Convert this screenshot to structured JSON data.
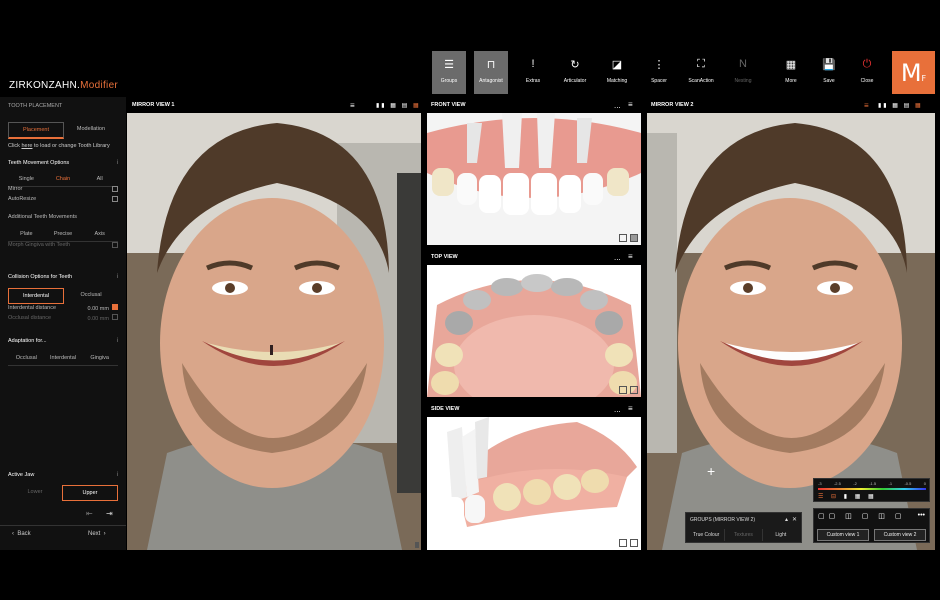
{
  "app": {
    "brand": "ZIRKONZAHN.",
    "product": "Modifier"
  },
  "toolbar": [
    {
      "label": "Groups",
      "icon": "menu-lines-icon"
    },
    {
      "label": "Antagonist",
      "icon": "antagonist-icon"
    },
    {
      "label": "Extras",
      "icon": "exclamation-icon"
    },
    {
      "label": "Articulator",
      "icon": "articulator-icon"
    },
    {
      "label": "Matching",
      "icon": "matching-icon"
    },
    {
      "label": "Spacer",
      "icon": "spacer-icon"
    },
    {
      "label": "ScanAction",
      "icon": "scan-action-icon"
    },
    {
      "label": "Nesting",
      "icon": "nesting-icon"
    },
    {
      "label": "More",
      "icon": "more-icon"
    },
    {
      "label": "Save",
      "icon": "save-icon"
    },
    {
      "label": "Close",
      "icon": "power-icon"
    }
  ],
  "brand_badge": {
    "letter": "M",
    "sub": "F",
    "color": "#e8703a"
  },
  "sidebar": {
    "title": "TOOTH PLACEMENT",
    "tabs": [
      "Placement",
      "Modellation"
    ],
    "library_text": [
      "Click",
      "here",
      "to load or change Tooth Library"
    ],
    "movement": {
      "title": "Teeth Movement Options",
      "modes": [
        "Single",
        "Chain",
        "All"
      ],
      "mirror": "Mirror",
      "autoresize": "AutoResize"
    },
    "additional": {
      "title": "Additional Teeth Movements",
      "modes": [
        "Plate",
        "Precise",
        "Axis"
      ],
      "morph": "Morph Gingiva with Teeth"
    },
    "collision": {
      "title": "Collision Options for Teeth",
      "modes": [
        "Interdental",
        "Occlusal"
      ],
      "interdental": "Interdental distance",
      "occlusal": "Occlusal distance",
      "value1": "0.00",
      "value2": "0.00",
      "unit": "mm"
    },
    "adaptation": {
      "title": "Adaptation for...",
      "modes": [
        "Occlusal",
        "Interdental",
        "Gingiva"
      ]
    },
    "jaw": {
      "title": "Active Jaw",
      "lower": "Lower",
      "upper": "Upper"
    },
    "nav": {
      "back": "Back",
      "next": "Next"
    },
    "info": "i"
  },
  "views": {
    "mirror1": "MIRROR VIEW 1",
    "front": "FRONT VIEW",
    "top": "TOP VIEW",
    "side": "SIDE VIEW",
    "mirror2": "MIRROR VIEW 2",
    "more": "..."
  },
  "groups": {
    "title": "GROUPS (MIRROR VIEW 2)",
    "items": [
      "True Colour",
      "Textures",
      "Light"
    ]
  },
  "scale": {
    "ticks": [
      "-3",
      "-2.5",
      "-2",
      "-1.5",
      "-1",
      "-0.5",
      "0"
    ]
  },
  "custom": [
    "Custom view 1",
    "Custom view 2"
  ]
}
